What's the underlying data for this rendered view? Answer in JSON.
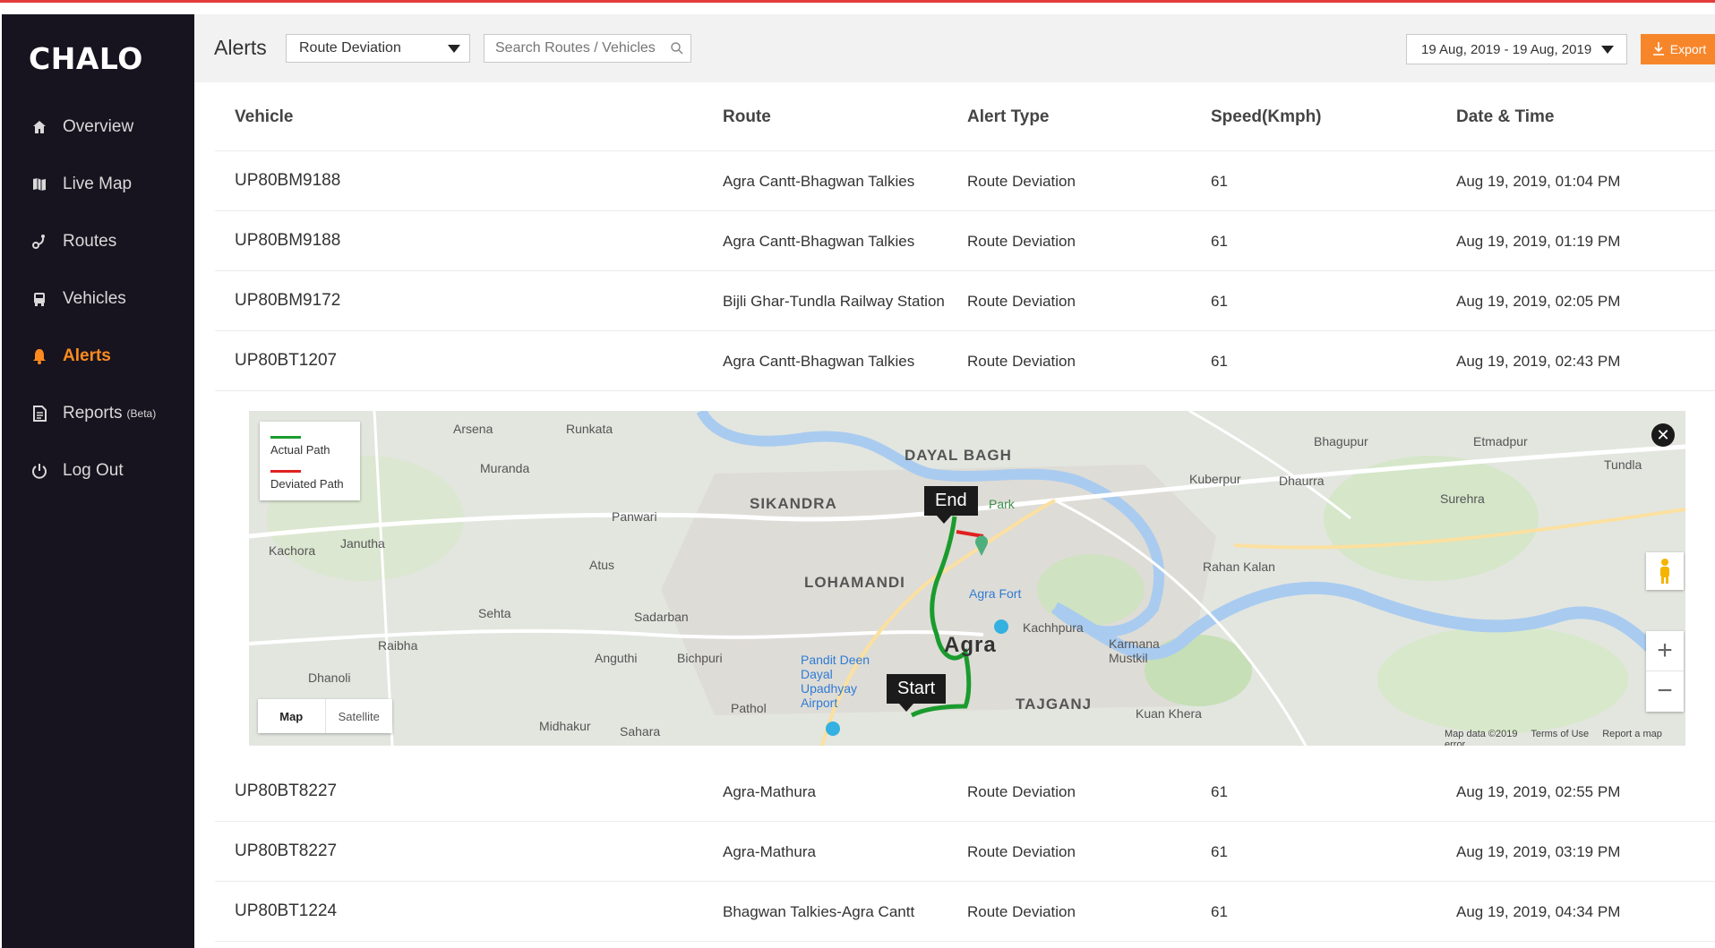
{
  "app": {
    "logo": "CHALO",
    "accent": "#ff8b1f"
  },
  "sidebar": {
    "items": [
      {
        "label": "Overview",
        "icon": "home-icon"
      },
      {
        "label": "Live Map",
        "icon": "map-icon"
      },
      {
        "label": "Routes",
        "icon": "route-icon"
      },
      {
        "label": "Vehicles",
        "icon": "bus-icon"
      },
      {
        "label": "Alerts",
        "icon": "bell-icon",
        "active": true
      },
      {
        "label": "Reports",
        "badge": "(Beta)",
        "icon": "report-icon"
      },
      {
        "label": "Log Out",
        "icon": "power-icon"
      }
    ]
  },
  "header": {
    "title": "Alerts",
    "filter_value": "Route Deviation",
    "search_placeholder": "Search Routes / Vehicles",
    "date_range": "19 Aug, 2019 - 19 Aug, 2019",
    "export_label": "Export"
  },
  "table": {
    "columns": [
      "Vehicle",
      "Route",
      "Alert Type",
      "Speed(Kmph)",
      "Date & Time"
    ],
    "rows": [
      {
        "vehicle": "UP80BM9188",
        "route": "Agra Cantt-Bhagwan Talkies",
        "alert_type": "Route Deviation",
        "speed": "61",
        "datetime": "Aug 19, 2019, 01:04 PM"
      },
      {
        "vehicle": "UP80BM9188",
        "route": "Agra Cantt-Bhagwan Talkies",
        "alert_type": "Route Deviation",
        "speed": "61",
        "datetime": "Aug 19, 2019, 01:19 PM"
      },
      {
        "vehicle": "UP80BM9172",
        "route": "Bijli Ghar-Tundla Railway Station",
        "alert_type": "Route Deviation",
        "speed": "61",
        "datetime": "Aug 19, 2019, 02:05 PM"
      },
      {
        "vehicle": "UP80BT1207",
        "route": "Agra Cantt-Bhagwan Talkies",
        "alert_type": "Route Deviation",
        "speed": "61",
        "datetime": "Aug 19, 2019, 02:43 PM"
      },
      {
        "vehicle": "UP80BT8227",
        "route": "Agra-Mathura",
        "alert_type": "Route Deviation",
        "speed": "61",
        "datetime": "Aug 19, 2019, 02:55 PM"
      },
      {
        "vehicle": "UP80BT8227",
        "route": "Agra-Mathura",
        "alert_type": "Route Deviation",
        "speed": "61",
        "datetime": "Aug 19, 2019, 03:19 PM"
      },
      {
        "vehicle": "UP80BT1224",
        "route": "Bhagwan Talkies-Agra Cantt",
        "alert_type": "Route Deviation",
        "speed": "61",
        "datetime": "Aug 19, 2019, 04:34 PM"
      }
    ]
  },
  "map": {
    "legend_actual": "Actual Path",
    "legend_deviated": "Deviated Path",
    "actual_color": "#1a9b2e",
    "deviated_color": "#e02020",
    "start_label": "Start",
    "end_label": "End",
    "type_map": "Map",
    "type_satellite": "Satellite",
    "attribution": [
      "Map data ©2019",
      "Terms of Use",
      "Report a map error"
    ],
    "places": [
      "DAYAL BAGH",
      "SIKANDRA",
      "LOHAMANDI",
      "Agra",
      "TAJGANJ",
      "Bhagupur",
      "Etmadpur",
      "Tundla",
      "Kuberpur",
      "Dhaurra",
      "Surehra",
      "Rahan Kalan",
      "Karmana Mustkil",
      "Kachhpura",
      "Kuan Khera",
      "Arsena",
      "Runkata",
      "Muranda",
      "Panwari",
      "Atus",
      "Kachora",
      "Janutha",
      "Sehta",
      "Sadarban",
      "Raibha",
      "Anguthi",
      "Bichpuri",
      "Dhanoli",
      "Pathol",
      "Midhakur",
      "Sahara",
      "Agra Fort",
      "Pandit Deen Dayal Upadhyay Airport",
      "Park"
    ]
  }
}
